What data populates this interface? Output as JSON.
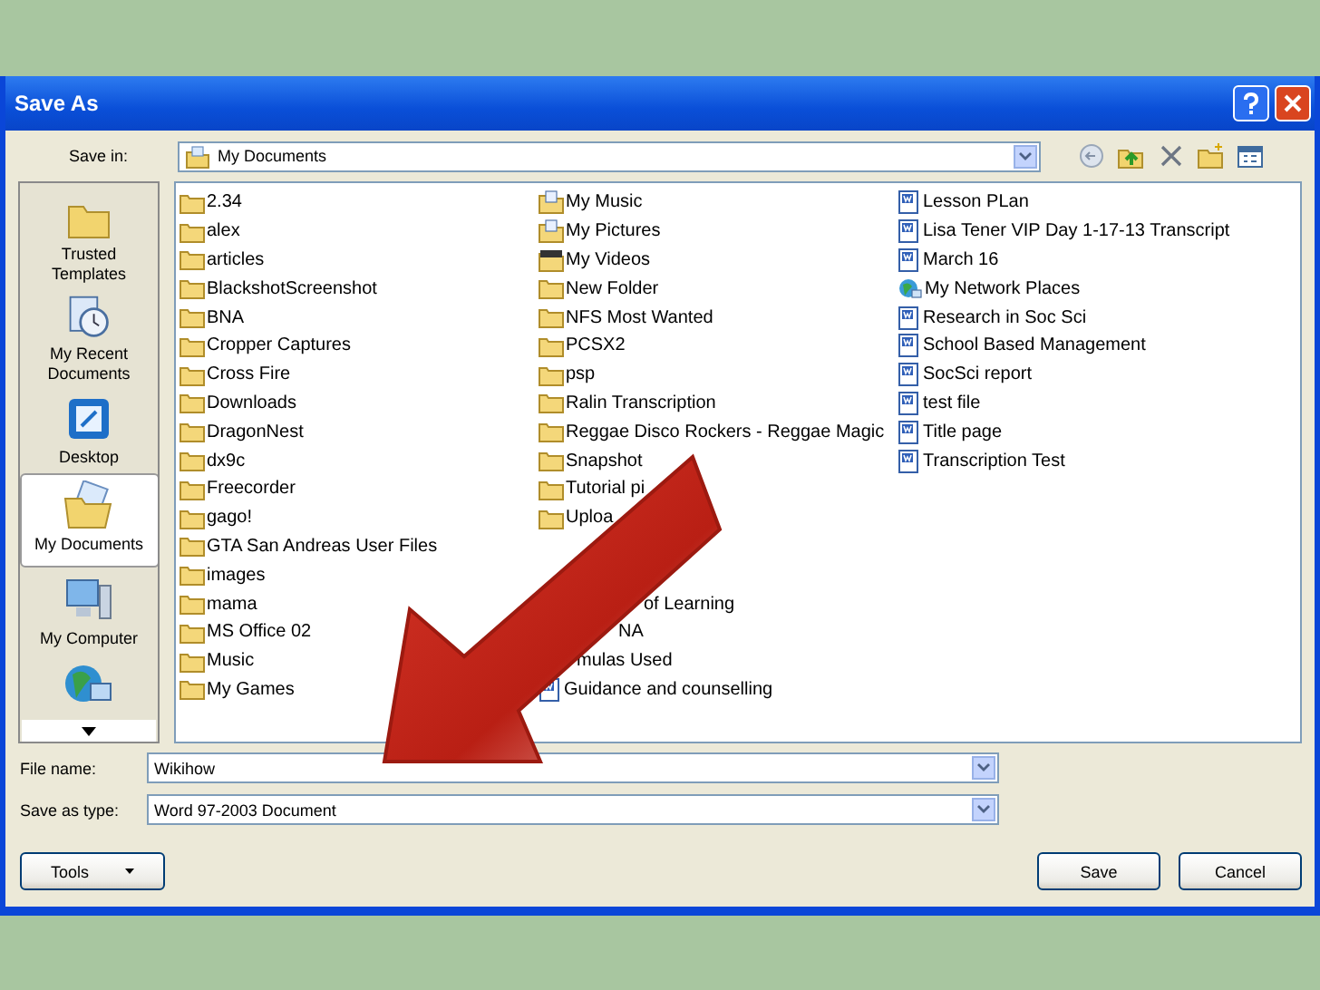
{
  "window": {
    "title": "Save As"
  },
  "save_in": {
    "label": "Save in:",
    "value": "My Documents"
  },
  "places": [
    {
      "label": "Trusted Templates",
      "kind": "templates",
      "selected": false
    },
    {
      "label": "My Recent Documents",
      "kind": "recent",
      "selected": false
    },
    {
      "label": "Desktop",
      "kind": "desktop",
      "selected": false
    },
    {
      "label": "My Documents",
      "kind": "documents",
      "selected": true
    },
    {
      "label": "My Computer",
      "kind": "computer",
      "selected": false
    },
    {
      "kind": "network",
      "selected": false
    }
  ],
  "files": [
    [
      {
        "name": "2.34",
        "kind": "folder"
      },
      {
        "name": "alex",
        "kind": "folder"
      },
      {
        "name": "articles",
        "kind": "folder"
      },
      {
        "name": "BlackshotScreenshot",
        "kind": "folder"
      },
      {
        "name": "BNA",
        "kind": "folder"
      },
      {
        "name": "Cropper Captures",
        "kind": "folder"
      },
      {
        "name": "Cross Fire",
        "kind": "folder"
      },
      {
        "name": "Downloads",
        "kind": "folder"
      },
      {
        "name": "DragonNest",
        "kind": "folder"
      },
      {
        "name": "dx9c",
        "kind": "folder"
      },
      {
        "name": "Freecorder",
        "kind": "folder"
      },
      {
        "name": "gago!",
        "kind": "folder"
      },
      {
        "name": "GTA San Andreas User Files",
        "kind": "folder"
      },
      {
        "name": "images",
        "kind": "folder"
      },
      {
        "name": "mama",
        "kind": "folder"
      },
      {
        "name": "MS Office 02",
        "kind": "folder"
      },
      {
        "name": "Music",
        "kind": "folder"
      },
      {
        "name": "My Games",
        "kind": "folder"
      }
    ],
    [
      {
        "name": "My Music",
        "kind": "music"
      },
      {
        "name": "My Pictures",
        "kind": "pictures"
      },
      {
        "name": "My Videos",
        "kind": "videos"
      },
      {
        "name": "New Folder",
        "kind": "folder"
      },
      {
        "name": "NFS Most Wanted",
        "kind": "folder"
      },
      {
        "name": "PCSX2",
        "kind": "folder"
      },
      {
        "name": "psp",
        "kind": "folder"
      },
      {
        "name": "Ralin Transcription",
        "kind": "folder"
      },
      {
        "name": "Reggae Disco Rockers - Reggae Magic",
        "kind": "folder"
      },
      {
        "name": "Snapshot",
        "kind": "folder"
      },
      {
        "name": "Tutorial pi",
        "kind": "folder"
      },
      {
        "name": "Uploa",
        "kind": "folder"
      },
      {
        "name": "of Learning",
        "kind": "fragment"
      },
      {
        "name": "NA",
        "kind": "fragment"
      },
      {
        "name": "mulas Used",
        "kind": "fragment"
      },
      {
        "name": "Guidance and counselling",
        "kind": "doc"
      }
    ],
    [
      {
        "name": "Lesson PLan",
        "kind": "doc"
      },
      {
        "name": "Lisa Tener VIP Day 1-17-13 Transcript",
        "kind": "doc"
      },
      {
        "name": "March 16",
        "kind": "doc"
      },
      {
        "name": "My Network Places",
        "kind": "network"
      },
      {
        "name": "Research in Soc Sci",
        "kind": "doc"
      },
      {
        "name": "School Based Management",
        "kind": "doc"
      },
      {
        "name": "SocSci report",
        "kind": "doc"
      },
      {
        "name": "test file",
        "kind": "doc"
      },
      {
        "name": "Title page",
        "kind": "doc"
      },
      {
        "name": "Transcription Test",
        "kind": "doc"
      }
    ]
  ],
  "file_name": {
    "label": "File name:",
    "value": "Wikihow"
  },
  "save_as_type": {
    "label": "Save as type:",
    "value": "Word 97-2003 Document"
  },
  "buttons": {
    "tools": "Tools",
    "save": "Save",
    "cancel": "Cancel"
  }
}
